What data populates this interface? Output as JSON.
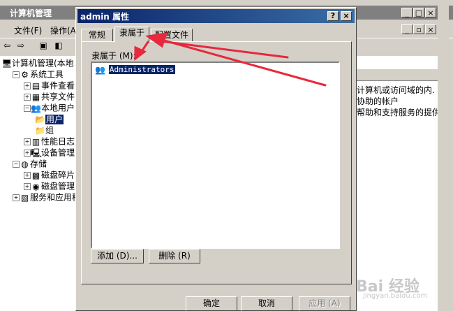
{
  "background_window": {
    "title": "计算机管理",
    "menu": [
      "文件(F)",
      "操作(A"
    ],
    "tree": [
      {
        "label": "计算机管理(本地",
        "indent": 0,
        "icon": "computer-icon"
      },
      {
        "label": "系统工具",
        "indent": 1,
        "icon": "tools-icon"
      },
      {
        "label": "事件查看",
        "indent": 2,
        "icon": "event-viewer-icon"
      },
      {
        "label": "共享文件",
        "indent": 2,
        "icon": "shared-folder-icon"
      },
      {
        "label": "本地用户",
        "indent": 2,
        "icon": "users-icon"
      },
      {
        "label": "用户",
        "indent": 3,
        "icon": "folder-open-icon",
        "selected": true
      },
      {
        "label": "组",
        "indent": 3,
        "icon": "folder-icon"
      },
      {
        "label": "性能日志",
        "indent": 2,
        "icon": "perf-log-icon"
      },
      {
        "label": "设备管理",
        "indent": 2,
        "icon": "device-manager-icon"
      },
      {
        "label": "存储",
        "indent": 1,
        "icon": "storage-icon"
      },
      {
        "label": "磁盘碎片",
        "indent": 2,
        "icon": "defrag-icon"
      },
      {
        "label": "磁盘管理",
        "indent": 2,
        "icon": "disk-icon"
      },
      {
        "label": "服务和应用程",
        "indent": 1,
        "icon": "services-icon"
      }
    ],
    "descriptions": [
      "计算机或访问域的内.",
      "协助的帐户",
      "帮助和支持服务的提供."
    ]
  },
  "dialog": {
    "title": "admin 属性",
    "help_label": "?",
    "close_label": "×",
    "tabs": [
      "常规",
      "隶属于",
      "配置文件"
    ],
    "active_tab": "隶属于",
    "member_of_label": "隶属于 (M):",
    "members": [
      "Administrators"
    ],
    "add_button": "添加 (D)...",
    "remove_button": "删除 (R)",
    "ok_button": "确定",
    "cancel_button": "取消",
    "apply_button": "应用 (A)"
  },
  "watermark": {
    "text": "Bai 经验",
    "sub": "jingyan.baidu.com"
  },
  "colors": {
    "title_active": "#0a246a",
    "title_inactive": "#808080",
    "face": "#d4d0c8",
    "arrow": "#e8283c"
  }
}
